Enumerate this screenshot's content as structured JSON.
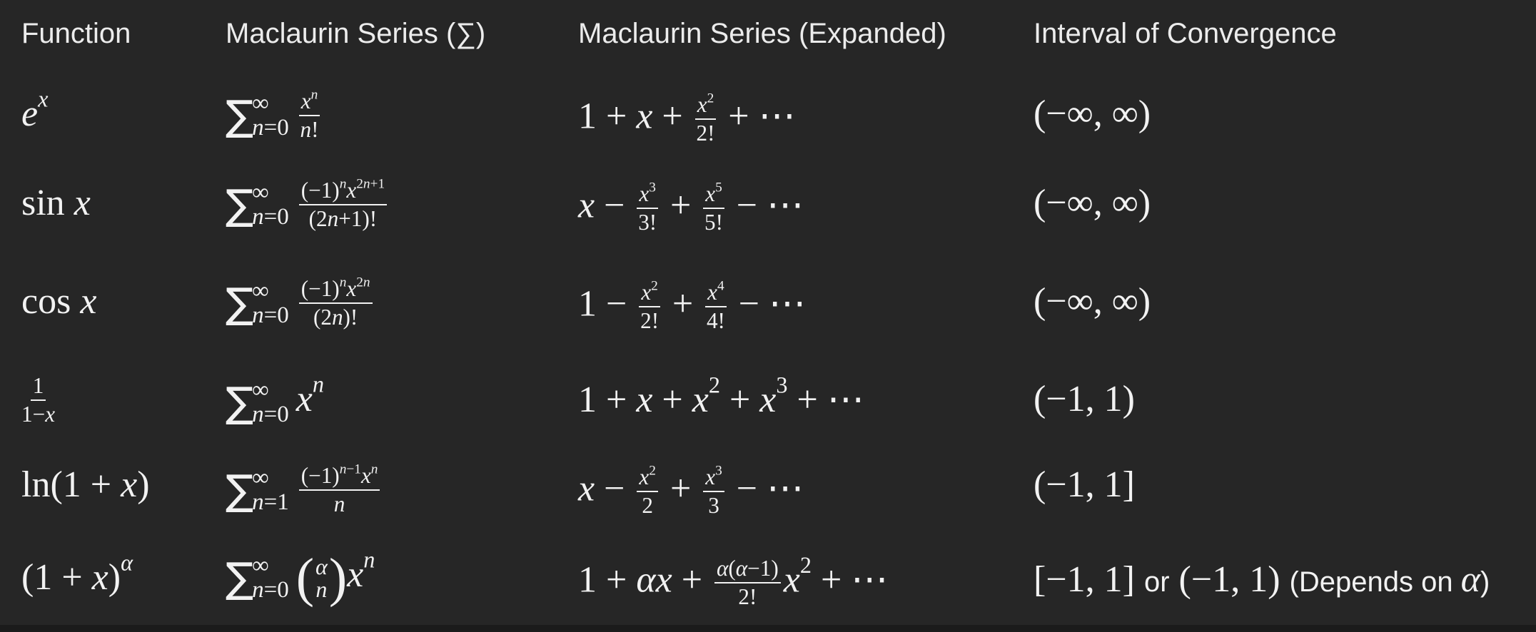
{
  "headers": {
    "function": "Function",
    "series_sigma": "Maclaurin Series (∑)",
    "series_expanded": "Maclaurin Series (Expanded)",
    "interval": "Interval of Convergence"
  },
  "rows": [
    {
      "function": "e^x",
      "series_sigma": "∑_{n=0}^{∞} x^n/n!",
      "series_expanded": "1 + x + x^2/2! + ⋯",
      "interval": "(−∞, ∞)"
    },
    {
      "function": "sin x",
      "series_sigma": "∑_{n=0}^{∞} (−1)^n x^{2n+1}/(2n+1)!",
      "series_expanded": "x − x^3/3! + x^5/5! − ⋯",
      "interval": "(−∞, ∞)"
    },
    {
      "function": "cos x",
      "series_sigma": "∑_{n=0}^{∞} (−1)^n x^{2n}/(2n)!",
      "series_expanded": "1 − x^2/2! + x^4/4! − ⋯",
      "interval": "(−∞, ∞)"
    },
    {
      "function": "1/(1−x)",
      "series_sigma": "∑_{n=0}^{∞} x^n",
      "series_expanded": "1 + x + x^2 + x^3 + ⋯",
      "interval": "(−1, 1)"
    },
    {
      "function": "ln(1 + x)",
      "series_sigma": "∑_{n=1}^{∞} (−1)^{n−1} x^n/n",
      "series_expanded": "x − x^2/2 + x^3/3 − ⋯",
      "interval": "(−1, 1]"
    },
    {
      "function": "(1 + x)^α",
      "series_sigma": "∑_{n=0}^{∞} (α choose n) x^n",
      "series_expanded": "1 + αx + α(α−1)/2! x^2 + ⋯",
      "interval": "[−1, 1] or (−1, 1) (Depends on α)"
    }
  ],
  "labels": {
    "or": "or",
    "depends_on": "(Depends on "
  }
}
